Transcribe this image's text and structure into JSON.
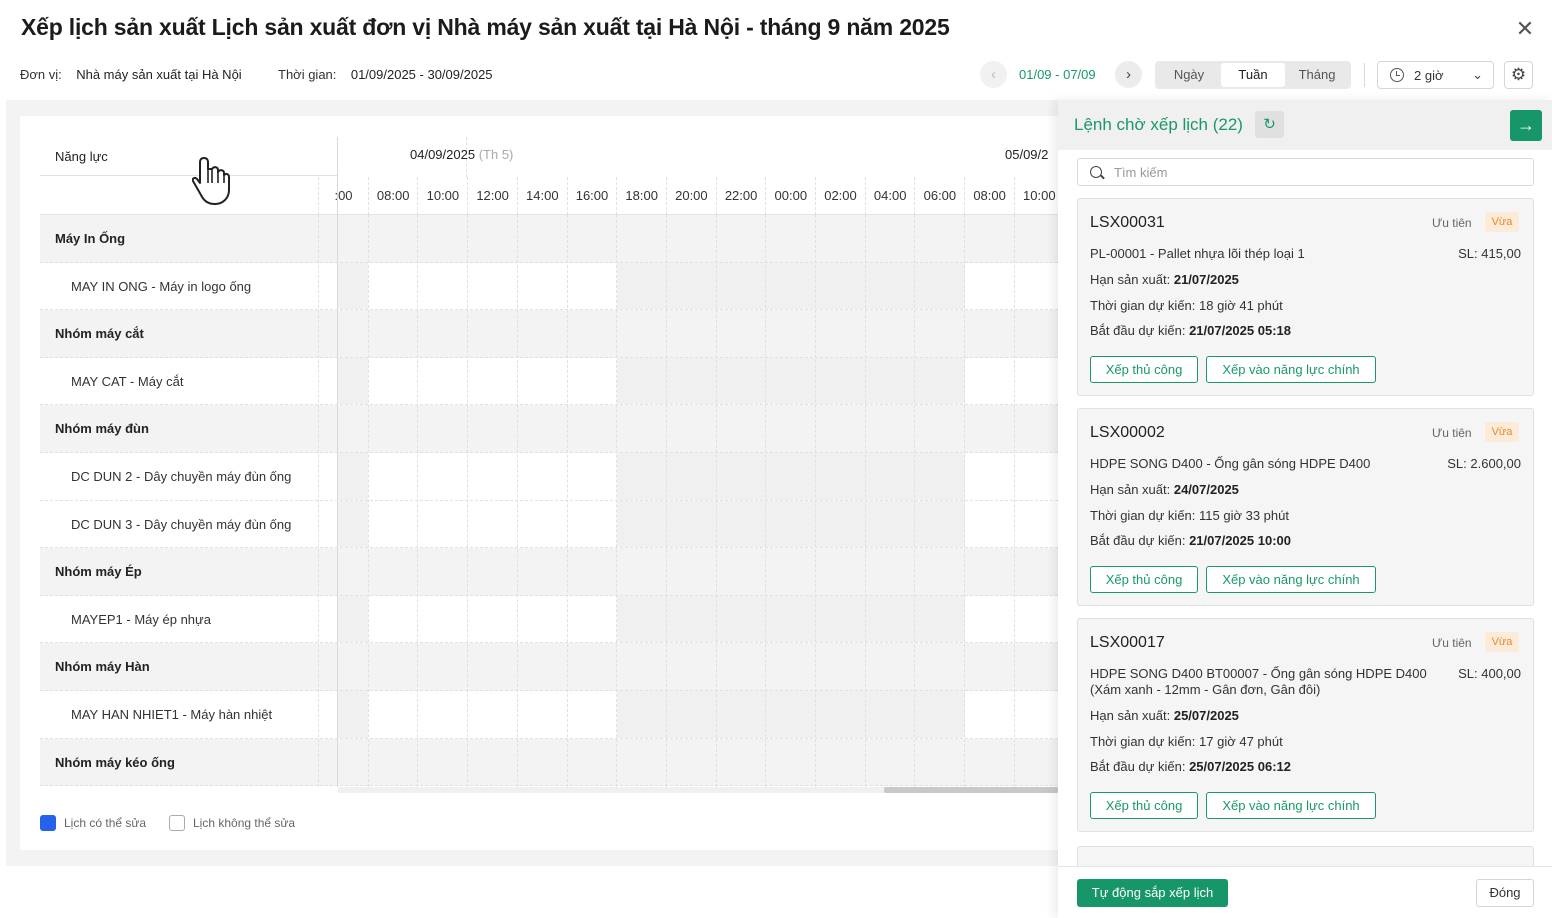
{
  "header": {
    "title": "Xếp lịch sản xuất Lịch sản xuất đơn vị Nhà máy sản xuất tại Hà Nội - tháng 9 năm 2025",
    "unit_label": "Đơn vị:",
    "unit_value": "Nhà máy sản xuất tại Hà Nội",
    "time_label": "Thời gian:",
    "time_value": "01/09/2025 - 30/09/2025",
    "range": "01/09 - 07/09",
    "views": [
      "Ngày",
      "Tuần",
      "Tháng"
    ],
    "active_view": "Tuần",
    "interval": "2 giờ"
  },
  "schedule": {
    "capacity_header": "Năng lực",
    "days": [
      {
        "date": "04/09/2025",
        "weekday": "(Th 5)"
      },
      {
        "date": "05/09/2"
      }
    ],
    "times": [
      ":00",
      "08:00",
      "10:00",
      "12:00",
      "14:00",
      "16:00",
      "18:00",
      "20:00",
      "22:00",
      "00:00",
      "02:00",
      "04:00",
      "06:00",
      "08:00",
      "10:00"
    ],
    "rows": [
      {
        "type": "group",
        "label": "Máy In Ống"
      },
      {
        "type": "item",
        "label": "MAY IN ONG - Máy in logo ống"
      },
      {
        "type": "group",
        "label": "Nhóm máy cắt"
      },
      {
        "type": "item",
        "label": "MAY CAT - Máy cắt"
      },
      {
        "type": "group",
        "label": "Nhóm máy đùn"
      },
      {
        "type": "item",
        "label": "DC DUN 2 - Dây chuyền máy đùn ống"
      },
      {
        "type": "item",
        "label": "DC DUN 3 - Dây chuyền máy đùn ống"
      },
      {
        "type": "group",
        "label": "Nhóm máy Ép"
      },
      {
        "type": "item",
        "label": "MAYEP1 - Máy ép nhựa"
      },
      {
        "type": "group",
        "label": "Nhóm máy Hàn"
      },
      {
        "type": "item",
        "label": "MAY HAN NHIET1 - Máy hàn nhiệt"
      },
      {
        "type": "group",
        "label": "Nhóm máy kéo ống"
      }
    ],
    "legend": {
      "editable": "Lịch có thể sửa",
      "locked": "Lịch không thể sửa",
      "editable_color": "#2563eb"
    }
  },
  "panel": {
    "title": "Lệnh chờ xếp lịch (22)",
    "search_placeholder": "Tìm kiếm",
    "jobs": [
      {
        "code": "LSX00031",
        "priority_label": "Ưu tiên",
        "priority": "Vừa",
        "product": "PL-00001 - Pallet nhựa lõi thép loại 1",
        "qty": "SL: 415,00",
        "deadline_label": "Hạn sản xuất:",
        "deadline": "21/07/2025",
        "duration_label": "Thời gian dự kiến:",
        "duration": "18 giờ 41 phút",
        "start_label": "Bắt đầu dự kiến:",
        "start": "21/07/2025 05:18",
        "btn_manual": "Xếp thủ công",
        "btn_main": "Xếp vào năng lực chính"
      },
      {
        "code": "LSX00002",
        "priority_label": "Ưu tiên",
        "priority": "Vừa",
        "product": "HDPE SONG D400 - Ống gân sóng HDPE D400",
        "qty": "SL: 2.600,00",
        "deadline_label": "Hạn sản xuất:",
        "deadline": "24/07/2025",
        "duration_label": "Thời gian dự kiến:",
        "duration": "115 giờ 33 phút",
        "start_label": "Bắt đầu dự kiến:",
        "start": "21/07/2025 10:00",
        "btn_manual": "Xếp thủ công",
        "btn_main": "Xếp vào năng lực chính"
      },
      {
        "code": "LSX00017",
        "priority_label": "Ưu tiên",
        "priority": "Vừa",
        "product": "HDPE SONG D400 BT00007 - Ống gân sóng HDPE D400 (Xám xanh - 12mm - Gân đơn, Gân đôi)",
        "qty": "SL: 400,00",
        "deadline_label": "Hạn sản xuất:",
        "deadline": "25/07/2025",
        "duration_label": "Thời gian dự kiến:",
        "duration": "17 giờ 47 phút",
        "start_label": "Bắt đầu dự kiến:",
        "start": "25/07/2025 06:12",
        "btn_manual": "Xếp thủ công",
        "btn_main": "Xếp vào năng lực chính"
      }
    ],
    "auto_button": "Tự động sắp xếp lịch",
    "close_button": "Đóng"
  }
}
